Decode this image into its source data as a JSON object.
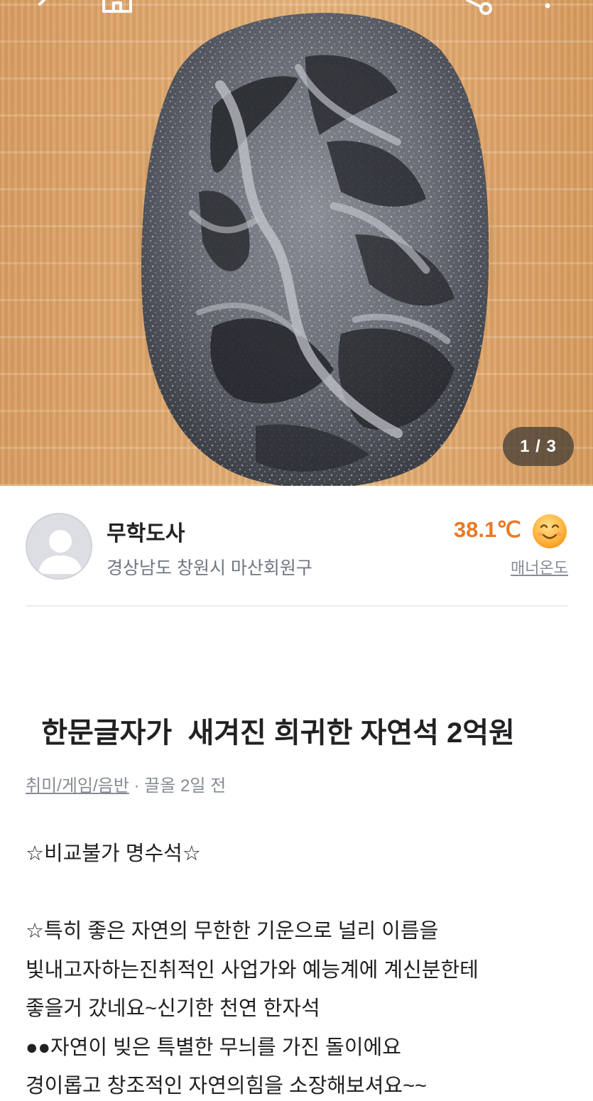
{
  "photo": {
    "description_icon": "stone-photo",
    "counter": "1 / 3"
  },
  "topbar": {
    "back_icon": "back-arrow-icon",
    "home_icon": "home-icon",
    "share_icon": "share-icon",
    "more_icon": "more-vertical-icon"
  },
  "seller": {
    "nickname": "무학도사",
    "region": "경상남도 창원시 마산회원구",
    "temperature": "38.1℃",
    "manner_label": "매너온도",
    "accent_color": "#e97a26"
  },
  "post": {
    "title": "한문글자가  새겨진 희귀한 자연석 2억원",
    "category": "취미/게임/음반",
    "time": " · 끌올 2일 전",
    "body_lines": [
      "☆비교불가 명수석☆",
      "",
      "☆특히 좋은 자연의 무한한 기운으로 널리 이름을",
      "빛내고자하는진취적인 사업가와 예능계에 계신분한테",
      "좋을거 갔네요~신기한 천연 한자석",
      "●●자연이 빚은 특별한 무늬를 가진 돌이에요",
      "경이롭고 창조적인 자연의힘을 소장해보셔요~~"
    ]
  }
}
